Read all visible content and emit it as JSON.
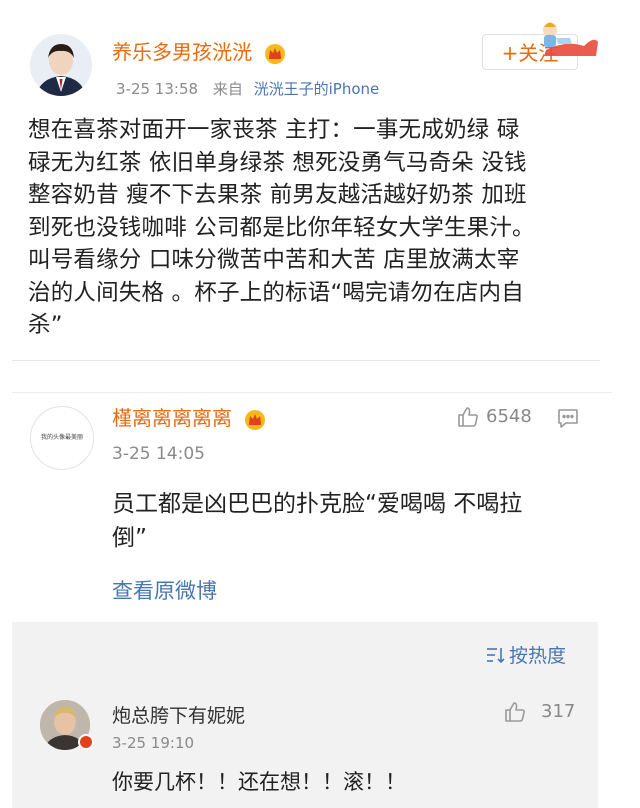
{
  "post": {
    "username": "养乐多男孩洸洸",
    "time": "3-25 13:58",
    "source_prefix": "来自",
    "source": "洸洸王子的iPhone",
    "follow_label": "+关注",
    "text": "想在喜茶对面开一家丧茶 主打：一事无成奶绿 碌\n碌无为红茶 依旧单身绿茶 想死没勇气马奇朵 没钱\n整容奶昔 瘦不下去果茶 前男友越活越好奶茶 加班\n到死也没钱咖啡 公司都是比你年轻女大学生果汁。\n叫号看缘分 口味分微苦中苦和大苦 店里放满太宰\n治的人间失格 。杯子上的标语“喝完请勿在店内自\n杀”"
  },
  "comment": {
    "username": "槿离离离离离",
    "avatar_text": "我的头像最美丽",
    "time": "3-25 14:05",
    "likes": "6548",
    "text": "员工都是凶巴巴的扑克脸“爱喝喝 不喝拉\n倒”",
    "view_original": "查看原微博"
  },
  "replies": {
    "sort_label": "按热度",
    "items": [
      {
        "username": "炮总胯下有妮妮",
        "time": "3-25 19:10",
        "likes": "317",
        "text": "你要几杯！！还在想！！滚！！"
      }
    ]
  },
  "colors": {
    "username": "#e86b0f",
    "link": "#4a76b0",
    "meta": "#8a8a8a"
  }
}
